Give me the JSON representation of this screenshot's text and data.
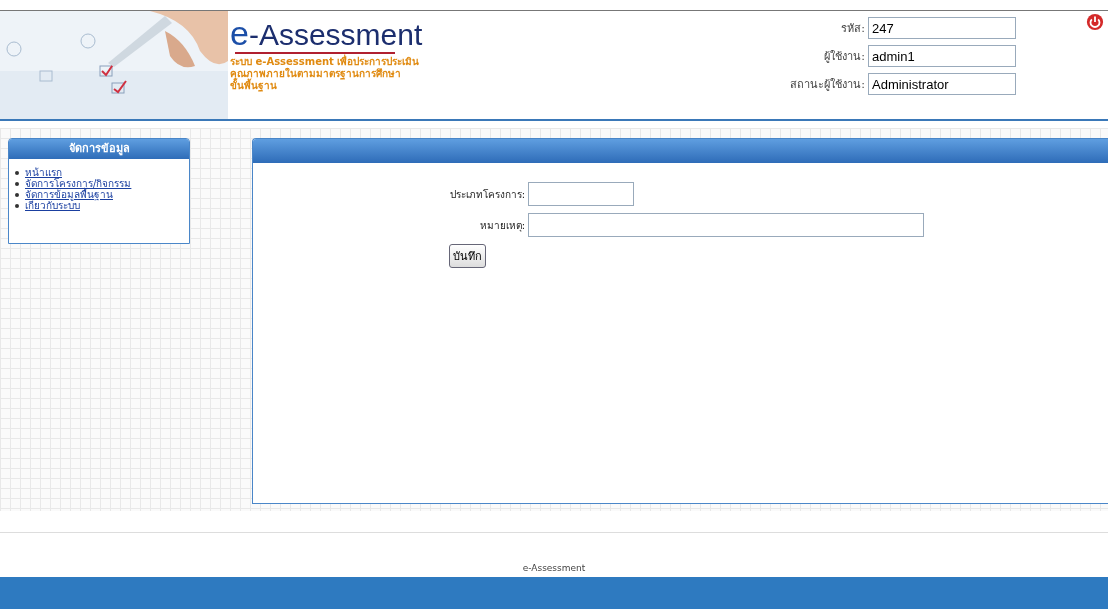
{
  "header": {
    "logo": "e-Assessment",
    "subtitle": [
      "ระบบ e-Assessment เพื่อประการประเมิน",
      "คุณภาพภายในตามมาตรฐานการศึกษา",
      "ขั้นพื้นฐาน"
    ],
    "fields": [
      {
        "label": "รหัส:",
        "value": "247"
      },
      {
        "label": "ผู้ใช้งาน:",
        "value": "admin1"
      },
      {
        "label": "สถานะผู้ใช้งาน:",
        "value": "Administrator"
      }
    ]
  },
  "sidebar": {
    "title": "จัดการข้อมูล",
    "items": [
      "หน้าแรก",
      "จัดการโครงการ/กิจกรรม",
      "จัดการข้อมูลพื้นฐาน",
      "เกี่ยวกับระบบ"
    ]
  },
  "form": {
    "fields": [
      {
        "label": "ประเภทโครงการ:",
        "kind": "short"
      },
      {
        "label": "หมายเหตุ:",
        "kind": "long"
      }
    ],
    "submit": "บันทึก"
  },
  "footer": "e-Assessment"
}
